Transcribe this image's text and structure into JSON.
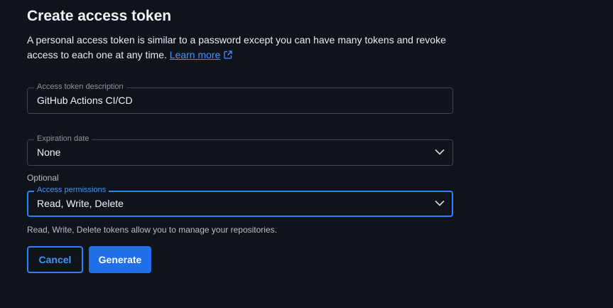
{
  "dialog": {
    "title": "Create access token",
    "description": "A personal access token is similar to a password except you can have many tokens and revoke access to each one at any time.",
    "learn_more": "Learn more"
  },
  "fields": {
    "description": {
      "label": "Access token description",
      "value": "GitHub Actions CI/CD"
    },
    "expiration": {
      "label": "Expiration date",
      "value": "None",
      "helper": "Optional"
    },
    "permissions": {
      "label": "Access permissions",
      "value": "Read, Write, Delete",
      "helper": "Read, Write, Delete tokens allow you to manage your repositories."
    }
  },
  "buttons": {
    "cancel": "Cancel",
    "generate": "Generate"
  },
  "colors": {
    "background": "#0f141b",
    "accent": "#2f81f7",
    "primary_button": "#1f6feb",
    "border": "#3d444d"
  },
  "icons": {
    "external_link": "external-link-icon",
    "dropdown": "chevron-down-icon"
  }
}
